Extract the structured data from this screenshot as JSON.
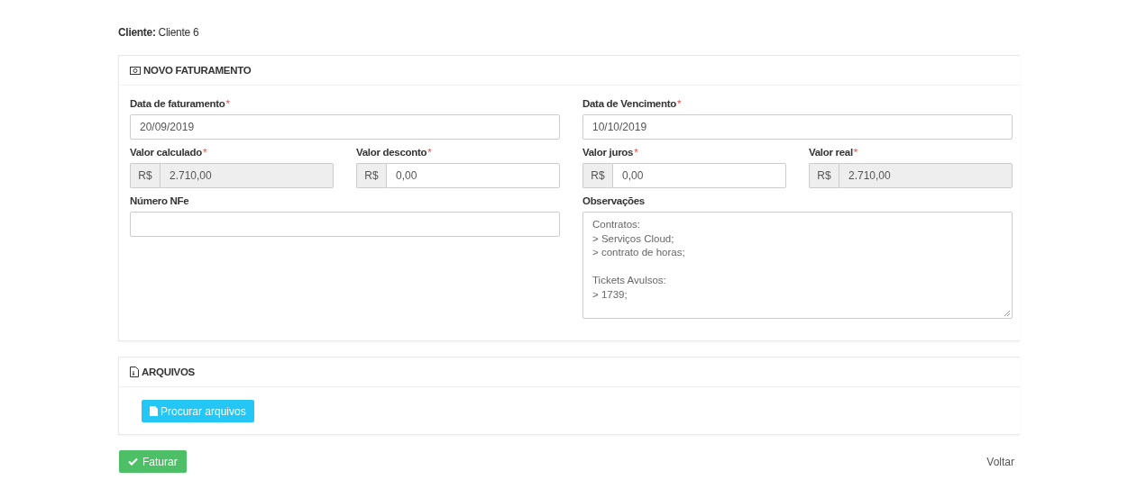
{
  "client": {
    "label": "Cliente:",
    "value": "Cliente 6"
  },
  "required_marker": "*",
  "billing_panel": {
    "title": "NOVO FATURAMENTO",
    "rows": [
      [
        {
          "kind": "text",
          "label": "Data de faturamento",
          "required": true,
          "value": "20/09/2019"
        },
        {
          "kind": "text",
          "label": "Data de Vencimento",
          "required": true,
          "value": "10/10/2019"
        }
      ],
      [
        {
          "kind": "money",
          "label": "Valor calculado",
          "required": true,
          "prefix": "R$",
          "value": "2.710,00",
          "disabled": true
        },
        {
          "kind": "money",
          "label": "Valor desconto",
          "required": true,
          "prefix": "R$",
          "value": "0,00",
          "disabled": false
        },
        {
          "kind": "money",
          "label": "Valor juros",
          "required": true,
          "prefix": "R$",
          "value": "0,00",
          "disabled": false
        },
        {
          "kind": "money",
          "label": "Valor real",
          "required": true,
          "prefix": "R$",
          "value": "2.710,00",
          "disabled": true
        }
      ],
      [
        {
          "kind": "text",
          "label": "Número NFe",
          "required": false
        },
        {
          "kind": "textarea",
          "label": "Observações",
          "required": false,
          "value": "Contratos:\n> Serviços Cloud;\n> contrato de horas;\n\nTickets Avulsos:\n> 1739;"
        }
      ]
    ]
  },
  "files_panel": {
    "title": "ARQUIVOS",
    "browse_button": "Procurar arquivos"
  },
  "actions": {
    "submit": "Faturar",
    "back": "Voltar"
  }
}
